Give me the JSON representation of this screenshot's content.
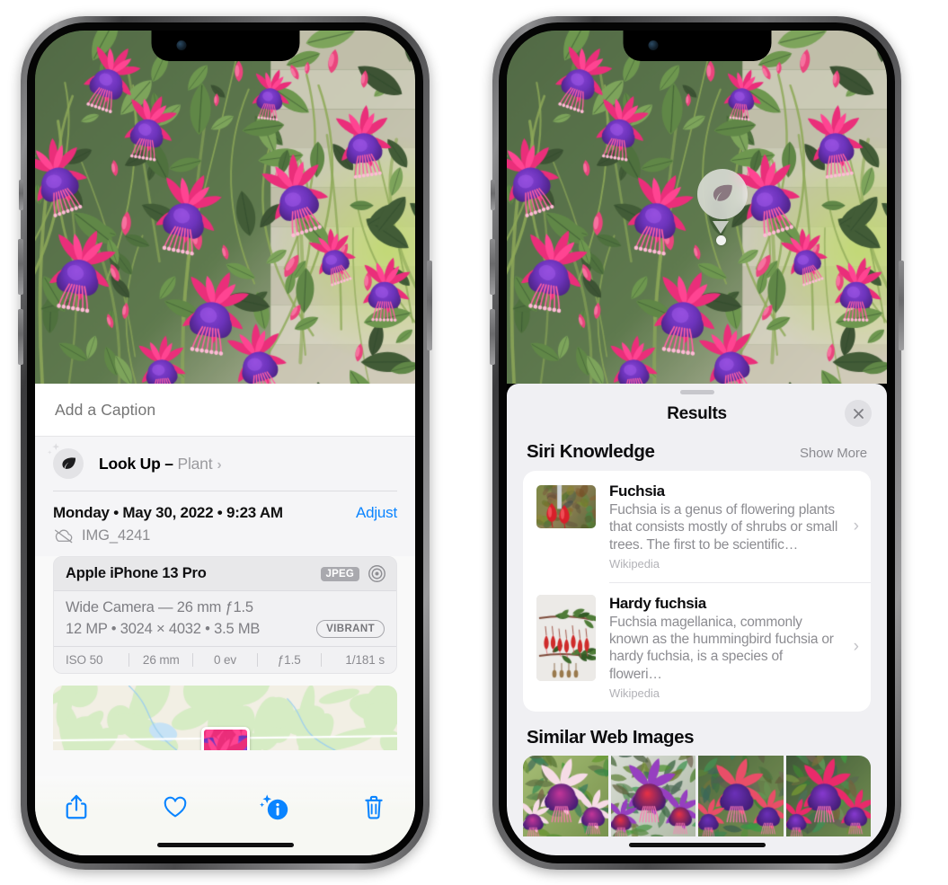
{
  "meta": {
    "accent_blue": "#0a84ff",
    "sheet_bg": "#f5f5f7",
    "results_bg": "#f0f0f3"
  },
  "left_phone": {
    "photo_alt": "fuchsia-flowers-photo",
    "caption": {
      "placeholder": "Add a Caption",
      "value": ""
    },
    "lookup": {
      "label": "Look Up",
      "separator": "–",
      "subject": "Plant",
      "chevron": "›",
      "icon": "leaf-icon"
    },
    "details": {
      "date": "Monday • May 30, 2022 • 9:23 AM",
      "adjust_label": "Adjust",
      "filename": "IMG_4241",
      "cloud_icon": "icloud-slash-icon"
    },
    "camera": {
      "model": "Apple iPhone 13 Pro",
      "format_tag": "JPEG",
      "aperture_icon": "aperture-icon",
      "lens_line": "Wide Camera — 26 mm ƒ1.5",
      "size_line": "12 MP • 3024 × 4032 • 3.5 MB",
      "style_tag": "VIBRANT",
      "exif": [
        "ISO 50",
        "26 mm",
        "0 ev",
        "ƒ1.5",
        "1/181 s"
      ]
    },
    "map": {
      "label": "photo-location-map"
    },
    "toolbar": [
      {
        "name": "share-button",
        "icon": "share-icon",
        "label": "Share"
      },
      {
        "name": "favorite-button",
        "icon": "heart-icon",
        "label": "Favorite"
      },
      {
        "name": "info-button",
        "icon": "info-sparkle-icon",
        "label": "Info"
      },
      {
        "name": "delete-button",
        "icon": "trash-icon",
        "label": "Delete"
      }
    ]
  },
  "right_phone": {
    "photo_alt": "fuchsia-flowers-photo",
    "visual_lookup_badge": {
      "icon": "leaf-icon",
      "label": "Visual Look Up"
    },
    "results": {
      "grabber": "sheet-grabber",
      "title": "Results",
      "close_label": "Close",
      "sections": [
        {
          "title": "Siri Knowledge",
          "action": "Show More",
          "items": [
            {
              "title": "Fuchsia",
              "description": "Fuchsia is a genus of flowering plants that consists mostly of shrubs or small trees. The first to be scientific…",
              "source": "Wikipedia",
              "thumb": "fuchsia-red-flowers-thumb",
              "chevron": "›"
            },
            {
              "title": "Hardy fuchsia",
              "description": "Fuchsia magellanica, commonly known as the hummingbird fuchsia or hardy fuchsia, is a species of floweri…",
              "source": "Wikipedia",
              "thumb": "hardy-fuchsia-specimen-thumb",
              "chevron": "›"
            }
          ]
        },
        {
          "title": "Similar Web Images",
          "action": "",
          "images": [
            "web-image-1",
            "web-image-2",
            "web-image-3",
            "web-image-4"
          ]
        }
      ]
    }
  }
}
